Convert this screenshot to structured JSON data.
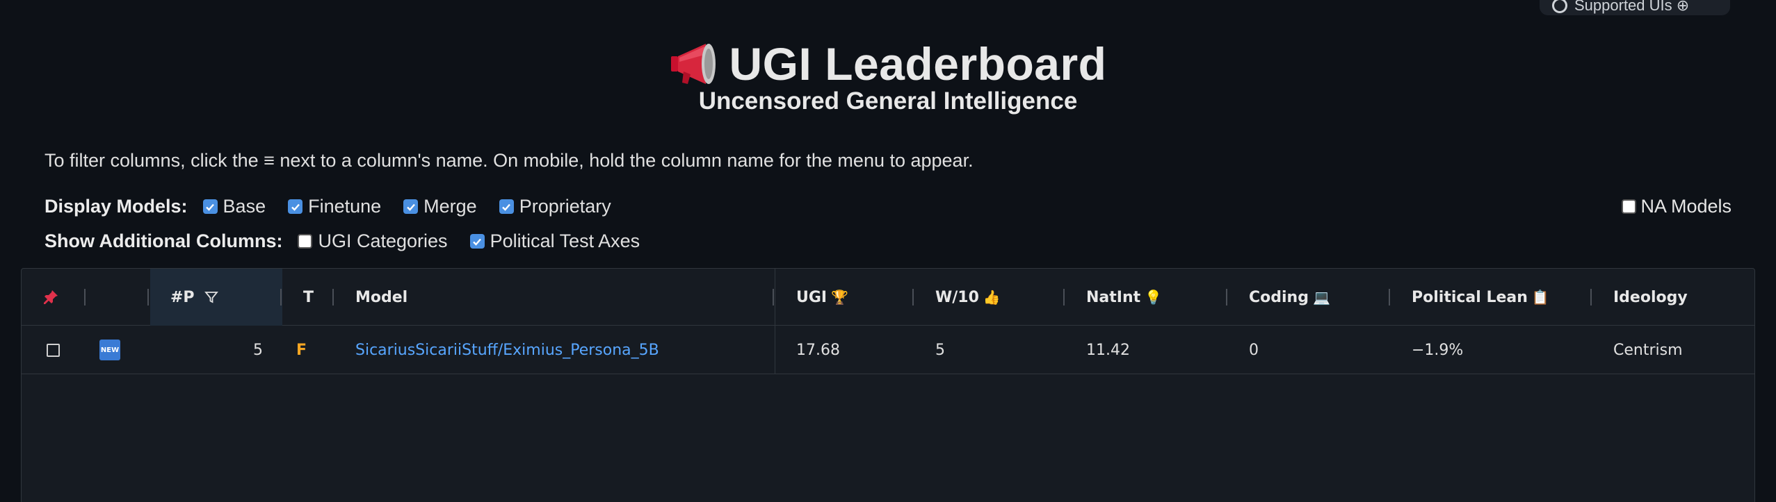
{
  "top_pill": {
    "text": "Supported UIs ⊕"
  },
  "header": {
    "title": "UGI Leaderboard",
    "subtitle": "Uncensored General Intelligence"
  },
  "instructions": "To filter columns, click the ≡ next to a column's name. On mobile, hold the column name for the menu to appear.",
  "display_models": {
    "label": "Display Models:",
    "options": [
      {
        "label": "Base",
        "checked": true
      },
      {
        "label": "Finetune",
        "checked": true
      },
      {
        "label": "Merge",
        "checked": true
      },
      {
        "label": "Proprietary",
        "checked": true
      }
    ],
    "na_models": {
      "label": "NA Models",
      "checked": false
    }
  },
  "additional_columns": {
    "label": "Show Additional Columns:",
    "options": [
      {
        "label": "UGI Categories",
        "checked": false
      },
      {
        "label": "Political Test Axes",
        "checked": true
      }
    ]
  },
  "table": {
    "columns": {
      "params": "#P",
      "type": "T",
      "model": "Model",
      "ugi": "UGI",
      "w10": "W/10",
      "natint": "NatInt",
      "coding": "Coding",
      "political_lean": "Political Lean",
      "ideology": "Ideology"
    },
    "column_icons": {
      "pin": "pin-icon",
      "params_filter": "filter-icon",
      "ugi": "🏆",
      "w10": "👍",
      "natint": "💡",
      "coding": "💻",
      "political_lean": "📋"
    },
    "rows": [
      {
        "badge": "NEW",
        "params": "5",
        "type": "F",
        "model": "SicariusSicariiStuff/Eximius_Persona_5B",
        "ugi": "17.68",
        "w10": "5",
        "natint": "11.42",
        "coding": "0",
        "political_lean": "−1.9%",
        "ideology": "Centrism"
      }
    ]
  },
  "colors": {
    "background": "#0d1117",
    "link": "#58a6ff",
    "checkbox": "#4a90e2",
    "type_f": "#f5a623"
  }
}
